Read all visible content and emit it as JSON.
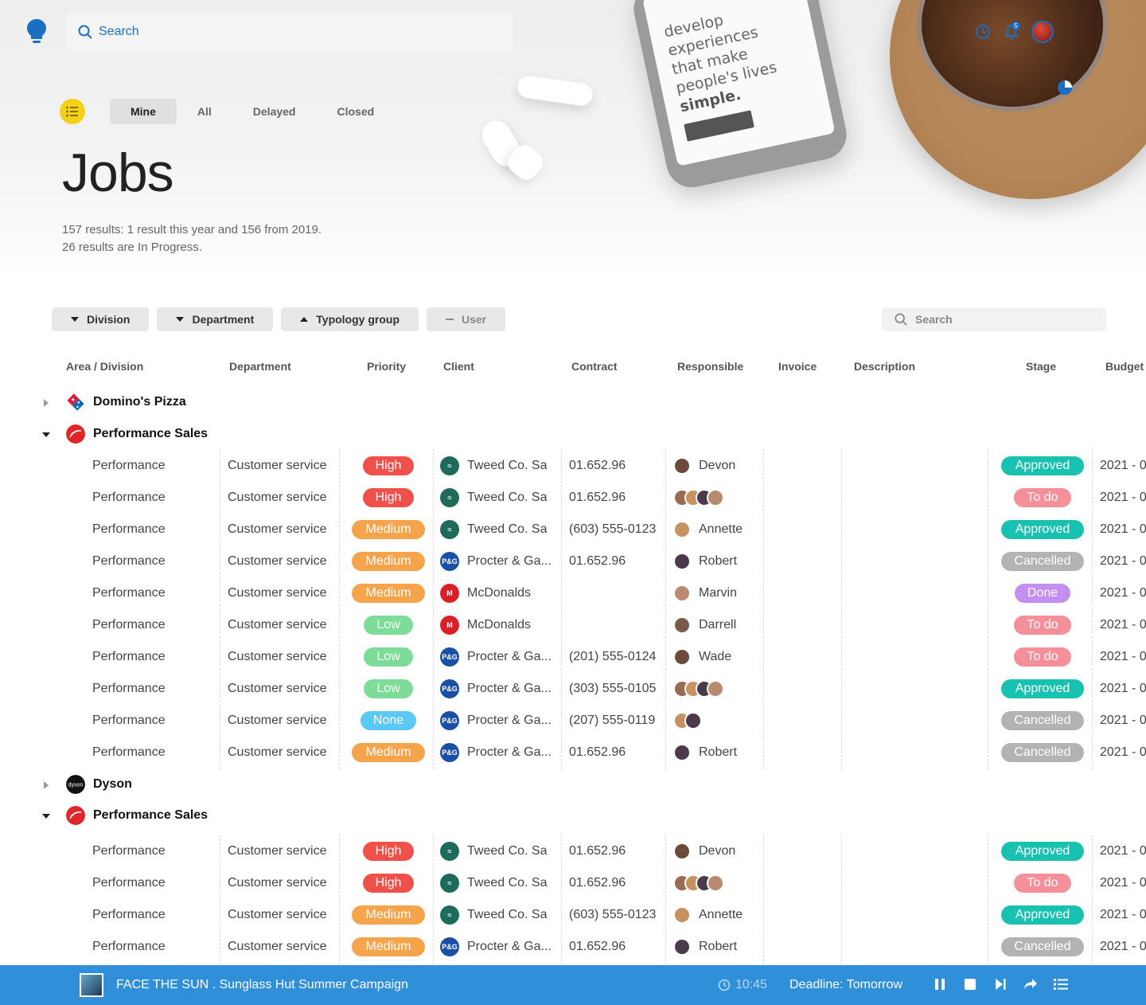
{
  "topbar": {
    "search_label": "Search",
    "notification_count": "5"
  },
  "tabs": [
    {
      "label": "Mine",
      "active": true
    },
    {
      "label": "All",
      "active": false
    },
    {
      "label": "Delayed",
      "active": false
    },
    {
      "label": "Closed",
      "active": false
    }
  ],
  "page_title": "Jobs",
  "summary": {
    "line1": "157 results: 1 result this year and 156 from 2019.",
    "line2": "26 results are In Progress."
  },
  "hero_phone_text": {
    "lines": [
      "develop",
      "experiences",
      "that make",
      "people's lives"
    ],
    "bold": "simple."
  },
  "filters": [
    {
      "label": "Division",
      "icon": "caret-down-icon"
    },
    {
      "label": "Department",
      "icon": "caret-down-icon"
    },
    {
      "label": "Typology group",
      "icon": "caret-up-icon"
    },
    {
      "label": "User",
      "icon": "minus-icon"
    }
  ],
  "table_search_placeholder": "Search",
  "columns": [
    "Area / Division",
    "Department",
    "Priority",
    "Client",
    "Contract",
    "Responsible",
    "Invoice",
    "Description",
    "Stage",
    "Budget"
  ],
  "colors": {
    "accent": "#2f8fd8",
    "priority": {
      "High": "#f0504a",
      "Medium": "#f5a44b",
      "Low": "#7cdc98",
      "None": "#5bc8f5"
    },
    "stage": {
      "Approved": "#19c2b0",
      "To do": "#f5909a",
      "Cancelled": "#b3b3b3",
      "Done": "#c48ff0"
    }
  },
  "groups_top": [
    {
      "name": "Domino's Pizza",
      "expanded": false,
      "logo": "dominos-logo"
    },
    {
      "name": "Performance Sales",
      "expanded": true,
      "logo": "northface-logo"
    }
  ],
  "groups_bottom": [
    {
      "name": "Dyson",
      "expanded": false,
      "logo": "dyson-logo"
    },
    {
      "name": "Performance Sales",
      "expanded": true,
      "logo": "northface-logo"
    }
  ],
  "rows_a": [
    {
      "area": "Performance",
      "department": "Customer service",
      "priority": "High",
      "client": "Tweed Co. Sa",
      "contract": "01.652.96",
      "responsible": "Devon",
      "stage": "Approved",
      "budget": "2021 - 0"
    },
    {
      "area": "Performance",
      "department": "Customer service",
      "priority": "High",
      "client": "Tweed Co. Sa",
      "contract": "01.652.96",
      "responsible": "",
      "stage": "To do",
      "budget": "2021 - 0"
    },
    {
      "area": "Performance",
      "department": "Customer service",
      "priority": "Medium",
      "client": "Tweed Co. Sa",
      "contract": "(603) 555-0123",
      "responsible": "Annette",
      "stage": "Approved",
      "budget": "2021 - 0"
    },
    {
      "area": "Performance",
      "department": "Customer service",
      "priority": "Medium",
      "client": "Procter & Ga...",
      "contract": "01.652.96",
      "responsible": "Robert",
      "stage": "Cancelled",
      "budget": "2021 - 0"
    },
    {
      "area": "Performance",
      "department": "Customer service",
      "priority": "Medium",
      "client": "McDonalds",
      "contract": "",
      "responsible": "Marvin",
      "stage": "Done",
      "budget": "2021 - 0"
    },
    {
      "area": "Performance",
      "department": "Customer service",
      "priority": "Low",
      "client": "McDonalds",
      "contract": "",
      "responsible": "Darrell",
      "stage": "To do",
      "budget": "2021 - 0"
    },
    {
      "area": "Performance",
      "department": "Customer service",
      "priority": "Low",
      "client": "Procter & Ga...",
      "contract": "(201) 555-0124",
      "responsible": "Wade",
      "stage": "To do",
      "budget": "2021 - 0"
    },
    {
      "area": "Performance",
      "department": "Customer service",
      "priority": "Low",
      "client": "Procter & Ga...",
      "contract": "(303) 555-0105",
      "responsible": "",
      "stage": "Approved",
      "budget": "2021 - 0"
    },
    {
      "area": "Performance",
      "department": "Customer service",
      "priority": "None",
      "client": "Procter & Ga...",
      "contract": "(207) 555-0119",
      "responsible": "",
      "stage": "Cancelled",
      "budget": "2021 - 0"
    },
    {
      "area": "Performance",
      "department": "Customer service",
      "priority": "Medium",
      "client": "Procter & Ga...",
      "contract": "01.652.96",
      "responsible": "Robert",
      "stage": "Cancelled",
      "budget": "2021 - 0"
    }
  ],
  "rows_b": [
    {
      "area": "Performance",
      "department": "Customer service",
      "priority": "High",
      "client": "Tweed Co. Sa",
      "contract": "01.652.96",
      "responsible": "Devon",
      "stage": "Approved",
      "budget": "2021 - 0"
    },
    {
      "area": "Performance",
      "department": "Customer service",
      "priority": "High",
      "client": "Tweed Co. Sa",
      "contract": "01.652.96",
      "responsible": "",
      "stage": "To do",
      "budget": "2021 - 0"
    },
    {
      "area": "Performance",
      "department": "Customer service",
      "priority": "Medium",
      "client": "Tweed Co. Sa",
      "contract": "(603) 555-0123",
      "responsible": "Annette",
      "stage": "Approved",
      "budget": "2021 - 0"
    },
    {
      "area": "Performance",
      "department": "Customer service",
      "priority": "Medium",
      "client": "Procter & Ga...",
      "contract": "01.652.96",
      "responsible": "Robert",
      "stage": "Cancelled",
      "budget": "2021 - 0"
    }
  ],
  "player": {
    "title": "FACE THE SUN . Sunglass Hut Summer Campaign",
    "time": "10:45",
    "deadline": "Deadline: Tomorrow"
  }
}
